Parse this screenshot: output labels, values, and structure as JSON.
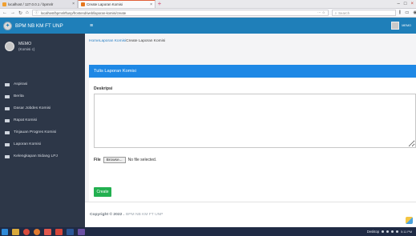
{
  "browser": {
    "tabs": [
      {
        "title": "localhost / 127.0.0.1 / bpmnlr",
        "active": false
      },
      {
        "title": "Create Laporan Komisi",
        "active": true
      }
    ],
    "url": "localhost/bpmnlrftunp/frontend/web/laporan-komisi/create",
    "search_placeholder": "Search"
  },
  "app": {
    "brand": "BPM NB KM FT UNP",
    "user_name": "MEMO",
    "user_role": "(Komisi c)",
    "topbar_user": "MEMO"
  },
  "sidebar": {
    "items": [
      {
        "label": "Aspirasi"
      },
      {
        "label": "Berita"
      },
      {
        "label": "Dasar Jobdes Komisi"
      },
      {
        "label": "Rapat Komisi"
      },
      {
        "label": "Tinjauan Progres Komisi"
      },
      {
        "label": "Laporan Komisi"
      },
      {
        "label": "Kelengkapan Sidang LPJ"
      }
    ]
  },
  "breadcrumb": {
    "home": "Home",
    "parent": "Laporan Komisi",
    "current": "Create Laporan Komisi"
  },
  "form": {
    "header": "Tulis Laporan Komisi",
    "description_label": "Deskripsi",
    "file_label": "File",
    "browse_label": "Browse...",
    "file_status": "No file selected.",
    "submit_label": "Create"
  },
  "footer": {
    "copyright": "Copyright © 2022 .",
    "org": "BPM NB KM FT UNP"
  },
  "taskbar": {
    "desktop_label": "Desktop",
    "time": "5:11 PM"
  },
  "colors": {
    "primary": "#1f7fb9",
    "header_blue": "#1e88e5",
    "sidebar_bg": "#2d3748",
    "success": "#23b050"
  }
}
